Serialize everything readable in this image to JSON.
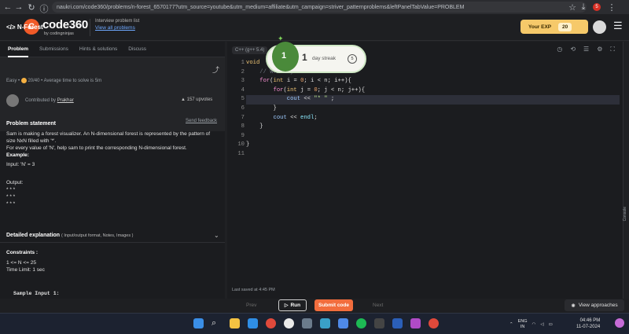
{
  "browser": {
    "url": "naukri.com/code360/problems/n-forest_6570177?utm_source=youtube&utm_medium=affiliate&utm_campaign=striver_patternproblems&leftPanelTabValue=PROBLEM",
    "profile_badge": "5"
  },
  "header": {
    "brand": "code360",
    "brand_sub": "by codingninjas",
    "interview_title": "Interview problem list",
    "interview_link": "View all problems",
    "exp_label": "Your EXP",
    "exp_value": "20"
  },
  "left_tabs": [
    "Problem",
    "Submissions",
    "Hints & solutions",
    "Discuss"
  ],
  "problem": {
    "title": "N-Forest",
    "difficulty": "Easy",
    "points": "20/40",
    "avg_time": "Average time to solve is 5m",
    "contributed_prefix": "Contributed by",
    "contributor": "Prakhar",
    "upvotes": "157 upvotes",
    "statement_heading": "Problem statement",
    "send_feedback": "Send feedback",
    "statement": "Sam is making a forest visualizer. An N-dimensional forest is represented by the pattern of size NxN filled with '*'.",
    "statement2": "For every value of 'N', help sam to print the corresponding N-dimensional forest.",
    "example_heading": "Example:",
    "input_line": "Input: 'N' = 3",
    "output_heading": "Output:",
    "output_rows": [
      "* * *",
      "* * *",
      "* * *"
    ],
    "detail_heading": "Detailed explanation",
    "detail_sub": "( Input/output format, Notes, Images )",
    "constraints_heading": "Constraints :",
    "constraint1": "1  <= N <= 25",
    "constraint2": "Time Limit: 1 sec",
    "sample_input": "Sample Input 1:"
  },
  "editor": {
    "language": "C++ (g++ 5.4)",
    "line_numbers": [
      "1",
      "2",
      "3",
      "4",
      "5",
      "6",
      "7",
      "8",
      "9",
      "10",
      "11"
    ],
    "saved": "Last saved at 4:45 PM"
  },
  "streak": {
    "count": "1",
    "label": "day streak",
    "badge": "5"
  },
  "console_label": "Console",
  "bottom": {
    "prev": "Prev",
    "run": "Run",
    "submit": "Submit code",
    "next": "Next",
    "view": "View approaches"
  },
  "taskbar": {
    "lang1": "ENG",
    "lang2": "IN",
    "time": "04:46 PM",
    "date": "11-07-2024"
  }
}
